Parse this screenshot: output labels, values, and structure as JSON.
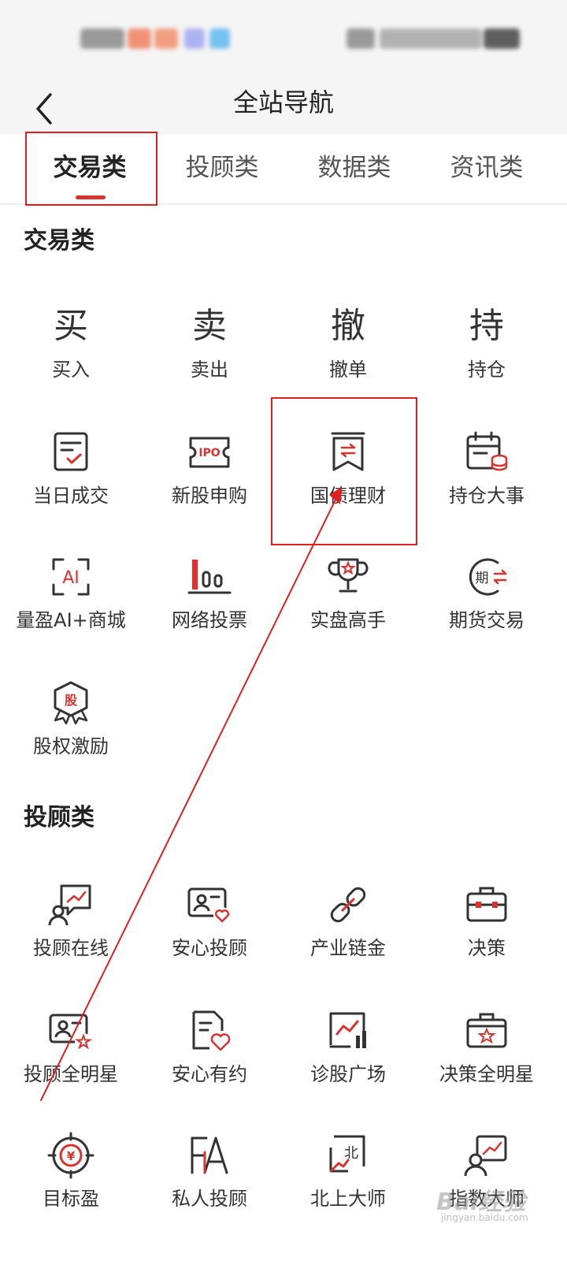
{
  "header": {
    "title": "全站导航",
    "back_icon": "chevron-left-icon"
  },
  "tabs": [
    {
      "label": "交易类",
      "active": true
    },
    {
      "label": "投顾类",
      "active": false
    },
    {
      "label": "数据类",
      "active": false
    },
    {
      "label": "资讯类",
      "active": false
    }
  ],
  "sections": [
    {
      "title": "交易类",
      "items": [
        {
          "label": "买入",
          "icon": "buy-glyph-icon",
          "glyph": "买"
        },
        {
          "label": "卖出",
          "icon": "sell-glyph-icon",
          "glyph": "卖"
        },
        {
          "label": "撤单",
          "icon": "cancel-order-glyph-icon",
          "glyph": "撤"
        },
        {
          "label": "持仓",
          "icon": "position-glyph-icon",
          "glyph": "持"
        },
        {
          "label": "当日成交",
          "icon": "checklist-icon"
        },
        {
          "label": "新股申购",
          "icon": "ipo-ticket-icon",
          "badge": "IPO"
        },
        {
          "label": "国债理财",
          "icon": "bond-bookmark-icon"
        },
        {
          "label": "持仓大事",
          "icon": "calendar-coins-icon"
        },
        {
          "label": "量盈AI+商城",
          "icon": "ai-scan-icon",
          "badge": "AI"
        },
        {
          "label": "网络投票",
          "icon": "vote-bars-icon"
        },
        {
          "label": "实盘高手",
          "icon": "trophy-icon"
        },
        {
          "label": "期货交易",
          "icon": "futures-exchange-icon",
          "badge": "期"
        },
        {
          "label": "股权激励",
          "icon": "equity-badge-icon",
          "badge": "股"
        }
      ]
    },
    {
      "title": "投顾类",
      "items": [
        {
          "label": "投顾在线",
          "icon": "advisor-chat-icon"
        },
        {
          "label": "安心投顾",
          "icon": "advisor-card-heart-icon"
        },
        {
          "label": "产业链金",
          "icon": "chain-link-icon"
        },
        {
          "label": "决策",
          "icon": "briefcase-icon"
        },
        {
          "label": "投顾全明星",
          "icon": "advisor-card-star-icon"
        },
        {
          "label": "安心有约",
          "icon": "document-heart-icon"
        },
        {
          "label": "诊股广场",
          "icon": "trend-chart-icon"
        },
        {
          "label": "决策全明星",
          "icon": "briefcase-star-icon"
        },
        {
          "label": "目标盈",
          "icon": "target-yuan-icon",
          "badge": "¥"
        },
        {
          "label": "私人投顾",
          "icon": "private-advisor-icon"
        },
        {
          "label": "北上大师",
          "icon": "northbound-icon",
          "badge": "北"
        },
        {
          "label": "指数大师",
          "icon": "index-master-icon"
        }
      ]
    }
  ],
  "watermark": {
    "main": "Bai经验",
    "sub": "jingyan.baidu.com"
  },
  "colors": {
    "accent": "#d9332f",
    "annotation": "#e02020",
    "icon_stroke": "#333333"
  }
}
